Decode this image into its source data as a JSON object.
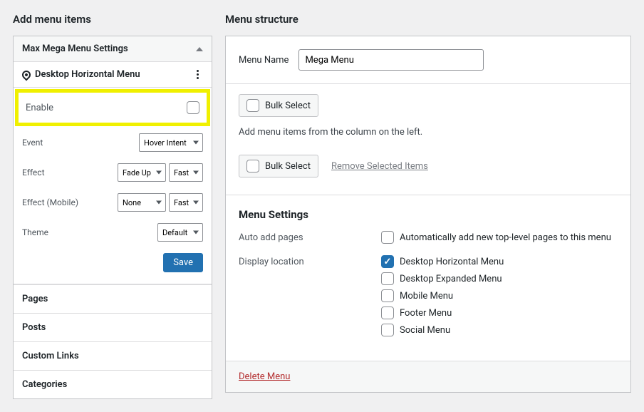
{
  "left": {
    "title": "Add menu items",
    "mega_settings_title": "Max Mega Menu Settings",
    "location_label": "Desktop Horizontal Menu",
    "enable_label": "Enable",
    "rows": {
      "event": {
        "label": "Event",
        "value": "Hover Intent"
      },
      "effect": {
        "label": "Effect",
        "value1": "Fade Up",
        "value2": "Fast"
      },
      "effect_mobile": {
        "label": "Effect (Mobile)",
        "value1": "None",
        "value2": "Fast"
      },
      "theme": {
        "label": "Theme",
        "value": "Default"
      }
    },
    "save_label": "Save",
    "accordion": [
      "Pages",
      "Posts",
      "Custom Links",
      "Categories"
    ]
  },
  "right": {
    "title": "Menu structure",
    "menu_name_label": "Menu Name",
    "menu_name_value": "Mega Menu",
    "bulk_select_label": "Bulk Select",
    "helper_text": "Add menu items from the column on the left.",
    "remove_selected_label": "Remove Selected Items",
    "settings_title": "Menu Settings",
    "auto_add_label": "Auto add pages",
    "auto_add_option": "Automatically add new top-level pages to this menu",
    "display_location_label": "Display location",
    "locations": [
      {
        "label": "Desktop Horizontal Menu",
        "checked": true
      },
      {
        "label": "Desktop Expanded Menu",
        "checked": false
      },
      {
        "label": "Mobile Menu",
        "checked": false
      },
      {
        "label": "Footer Menu",
        "checked": false
      },
      {
        "label": "Social Menu",
        "checked": false
      }
    ],
    "delete_label": "Delete Menu"
  }
}
